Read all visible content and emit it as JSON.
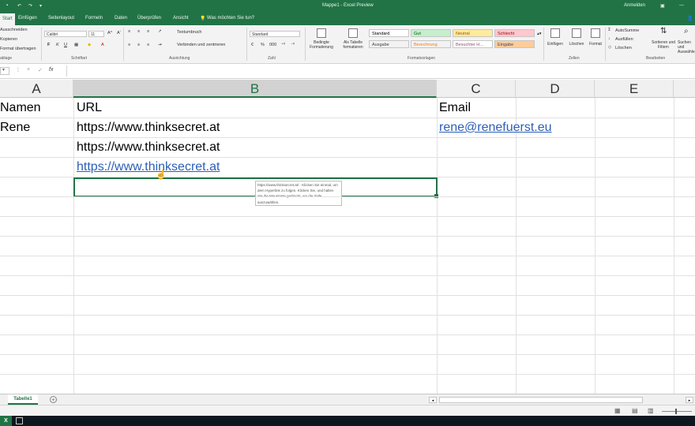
{
  "titlebar": {
    "title": "Mappe1 - Excel Preview",
    "user": "Anmelden"
  },
  "tabs": [
    "Start",
    "Einfügen",
    "Seitenlayout",
    "Formeln",
    "Daten",
    "Überprüfen",
    "Ansicht"
  ],
  "tell_me": "Was möchten Sie tun?",
  "ribbon": {
    "clipboard": {
      "cut": "Ausschneiden",
      "copy": "Kopieren",
      "format_painter": "Format übertragen",
      "group": "ablage"
    },
    "font": {
      "name": "Calibri",
      "size": "11",
      "group": "Schriftart",
      "bold": "F",
      "italic": "K",
      "underline": "U"
    },
    "alignment": {
      "wrap": "Textumbruch",
      "merge": "Verbinden und zentrieren",
      "group": "Ausrichtung"
    },
    "number": {
      "format": "Standard",
      "percent": "%",
      "thousands": "000",
      "group": "Zahl"
    },
    "styles": {
      "conditional": "Bedingte Formatierung",
      "as_table": "Als Tabelle formatieren",
      "cells": [
        {
          "label": "Standard",
          "bg": "#ffffff",
          "fg": "#000000"
        },
        {
          "label": "Gut",
          "bg": "#c6efce",
          "fg": "#006100"
        },
        {
          "label": "Neutral",
          "bg": "#ffeb9c",
          "fg": "#9c5700"
        },
        {
          "label": "Schlecht",
          "bg": "#ffc7ce",
          "fg": "#9c0006"
        },
        {
          "label": "Ausgabe",
          "bg": "#f2f2f2",
          "fg": "#3f3f3f"
        },
        {
          "label": "Berechnung",
          "bg": "#f2f2f2",
          "fg": "#fa7d00"
        },
        {
          "label": "Besuchter H...",
          "bg": "#ffffff",
          "fg": "#954f72"
        },
        {
          "label": "Eingabe",
          "bg": "#ffcc99",
          "fg": "#3f3f76"
        }
      ],
      "group": "Formatvorlagen"
    },
    "cells_group": {
      "insert": "Einfügen",
      "delete": "Löschen",
      "format": "Format",
      "group": "Zellen"
    },
    "editing": {
      "autosum": "AutoSumme",
      "fill": "Ausfüllen",
      "clear": "Löschen",
      "sort": "Sortieren und Filtern",
      "find": "Suchen und Auswählen",
      "group": "Bearbeiten"
    }
  },
  "formula_bar": {
    "name_box": "",
    "cancel": "×",
    "enter": "✓",
    "fx": "fx",
    "content": ""
  },
  "grid": {
    "columns": [
      "A",
      "B",
      "C",
      "D",
      "E"
    ],
    "selected_column": "B",
    "rows": [
      {
        "A": "Namen",
        "B": "URL",
        "C": "Email"
      },
      {
        "A": "Rene",
        "B": "https://www.thinksecret.at",
        "C": "rene@renefuerst.eu"
      },
      {
        "A": "",
        "B": "https://www.thinksecret.at",
        "C": ""
      },
      {
        "A": "",
        "B": "https://www.thinksecret.at",
        "C": ""
      }
    ]
  },
  "tooltip": "https://www.thinksecret.at/ - Klicken Sie einmal, um dem Hyperlink zu folgen. Klicken Sie, und halten Sie die Maustaste gedrückt, um die Zelle auszuwählen.",
  "sheet": {
    "name": "Tabelle1",
    "add": "+"
  },
  "colors": {
    "excel_green": "#217346",
    "link_blue": "#2b5fb6"
  }
}
